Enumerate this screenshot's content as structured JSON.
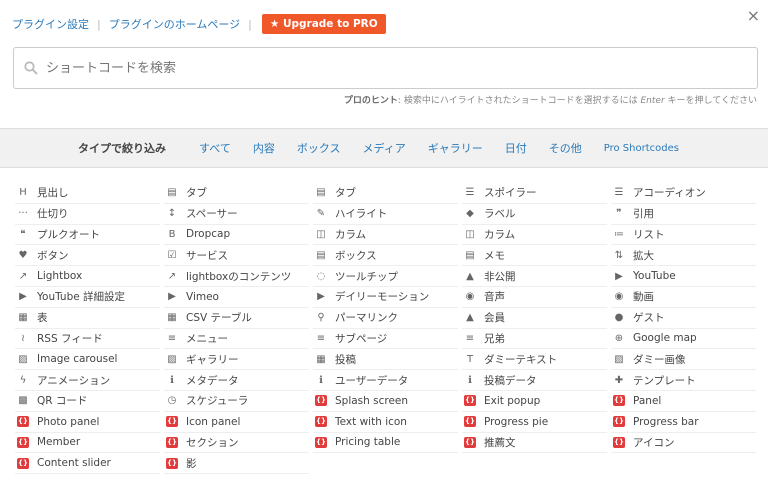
{
  "header": {
    "settings": "プラグイン設定",
    "homepage": "プラグインのホームページ",
    "upgrade": "★ Upgrade to PRO",
    "close": "×"
  },
  "search": {
    "placeholder": "ショートコードを検索"
  },
  "hint": {
    "label": "プロのヒント",
    "text": ": 検索中にハイライトされたショートコードを選択するには ",
    "key": "Enter",
    "tail": " キーを押してください"
  },
  "filter": {
    "label": "タイプで絞り込み",
    "options": [
      "すべて",
      "内容",
      "ボックス",
      "メディア",
      "ギャラリー",
      "日付",
      "その他",
      "Pro Shortcodes"
    ]
  },
  "items": [
    {
      "label": "見出し",
      "icon": "heading-icon",
      "g": "H"
    },
    {
      "label": "タブ",
      "icon": "tabs-icon",
      "g": "▤"
    },
    {
      "label": "タブ",
      "icon": "tab-icon",
      "g": "▤"
    },
    {
      "label": "スポイラー",
      "icon": "list-icon",
      "g": "☰"
    },
    {
      "label": "アコーディオン",
      "icon": "list-icon",
      "g": "☰"
    },
    {
      "label": "仕切り",
      "icon": "ellipsis-icon",
      "g": "···"
    },
    {
      "label": "スペーサー",
      "icon": "arrows-vertical-icon",
      "g": "↕"
    },
    {
      "label": "ハイライト",
      "icon": "pencil-icon",
      "g": "✎"
    },
    {
      "label": "ラベル",
      "icon": "tag-icon",
      "g": "◆"
    },
    {
      "label": "引用",
      "icon": "quote-icon",
      "g": "❞"
    },
    {
      "label": "プルクオート",
      "icon": "quote-left-icon",
      "g": "❝"
    },
    {
      "label": "Dropcap",
      "icon": "bold-icon",
      "g": "B"
    },
    {
      "label": "カラム",
      "icon": "columns-icon",
      "g": "◫"
    },
    {
      "label": "カラム",
      "icon": "columns-icon",
      "g": "◫"
    },
    {
      "label": "リスト",
      "icon": "list-ol-icon",
      "g": "≔"
    },
    {
      "label": "ボタン",
      "icon": "heart-icon",
      "g": "♥"
    },
    {
      "label": "サービス",
      "icon": "check-square-icon",
      "g": "☑"
    },
    {
      "label": "ボックス",
      "icon": "box-icon",
      "g": "▤"
    },
    {
      "label": "メモ",
      "icon": "note-icon",
      "g": "▤"
    },
    {
      "label": "拡大",
      "icon": "sort-icon",
      "g": "⇅"
    },
    {
      "label": "Lightbox",
      "icon": "external-link-icon",
      "g": "↗"
    },
    {
      "label": "lightboxのコンテンツ",
      "icon": "external-link-icon",
      "g": "↗"
    },
    {
      "label": "ツールチップ",
      "icon": "comment-icon",
      "g": "◌"
    },
    {
      "label": "非公開",
      "icon": "lock-icon",
      "g": "▲"
    },
    {
      "label": "YouTube",
      "icon": "youtube-icon",
      "g": "▶"
    },
    {
      "label": "YouTube 詳細設定",
      "icon": "youtube-icon",
      "g": "▶"
    },
    {
      "label": "Vimeo",
      "icon": "youtube-icon",
      "g": "▶"
    },
    {
      "label": "デイリーモーション",
      "icon": "youtube-icon",
      "g": "▶"
    },
    {
      "label": "音声",
      "icon": "play-circle-icon",
      "g": "◉"
    },
    {
      "label": "動画",
      "icon": "play-circle-icon",
      "g": "◉"
    },
    {
      "label": "表",
      "icon": "table-icon",
      "g": "▦"
    },
    {
      "label": "CSV テーブル",
      "icon": "table-icon",
      "g": "▦"
    },
    {
      "label": "パーマリンク",
      "icon": "link-icon",
      "g": "⚲"
    },
    {
      "label": "会員",
      "icon": "lock-icon",
      "g": "▲"
    },
    {
      "label": "ゲスト",
      "icon": "user-icon",
      "g": "●"
    },
    {
      "label": "RSS フィード",
      "icon": "rss-icon",
      "g": "≀"
    },
    {
      "label": "メニュー",
      "icon": "bars-icon",
      "g": "≡"
    },
    {
      "label": "サブページ",
      "icon": "bars-icon",
      "g": "≡"
    },
    {
      "label": "兄弟",
      "icon": "bars-icon",
      "g": "≡"
    },
    {
      "label": "Google map",
      "icon": "globe-icon",
      "g": "⊕"
    },
    {
      "label": "Image carousel",
      "icon": "image-icon",
      "g": "▨"
    },
    {
      "label": "ギャラリー",
      "icon": "image-icon",
      "g": "▨"
    },
    {
      "label": "投稿",
      "icon": "th-list-icon",
      "g": "▦"
    },
    {
      "label": "ダミーテキスト",
      "icon": "text-height-icon",
      "g": "T"
    },
    {
      "label": "ダミー画像",
      "icon": "image-icon",
      "g": "▨"
    },
    {
      "label": "アニメーション",
      "icon": "bolt-icon",
      "g": "ϟ"
    },
    {
      "label": "メタデータ",
      "icon": "info-icon",
      "g": "ℹ"
    },
    {
      "label": "ユーザーデータ",
      "icon": "info-icon",
      "g": "ℹ"
    },
    {
      "label": "投稿データ",
      "icon": "info-icon",
      "g": "ℹ"
    },
    {
      "label": "テンプレート",
      "icon": "puzzle-icon",
      "g": "✚"
    },
    {
      "label": "QR コード",
      "icon": "qrcode-icon",
      "g": "▩"
    },
    {
      "label": "スケジューラ",
      "icon": "clock-icon",
      "g": "◷"
    },
    {
      "label": "Splash screen",
      "icon": "pro-icon",
      "g": "{}",
      "pro": true
    },
    {
      "label": "Exit popup",
      "icon": "pro-icon",
      "g": "{}",
      "pro": true
    },
    {
      "label": "Panel",
      "icon": "pro-icon",
      "g": "{}",
      "pro": true
    },
    {
      "label": "Photo panel",
      "icon": "pro-icon",
      "g": "{}",
      "pro": true
    },
    {
      "label": "Icon panel",
      "icon": "pro-icon",
      "g": "{}",
      "pro": true
    },
    {
      "label": "Text with icon",
      "icon": "pro-icon",
      "g": "{}",
      "pro": true
    },
    {
      "label": "Progress pie",
      "icon": "pro-icon",
      "g": "{}",
      "pro": true
    },
    {
      "label": "Progress bar",
      "icon": "pro-icon",
      "g": "{}",
      "pro": true
    },
    {
      "label": "Member",
      "icon": "pro-icon",
      "g": "{}",
      "pro": true
    },
    {
      "label": "セクション",
      "icon": "pro-icon",
      "g": "{}",
      "pro": true
    },
    {
      "label": "Pricing table",
      "icon": "pro-icon",
      "g": "{}",
      "pro": true
    },
    {
      "label": "推薦文",
      "icon": "pro-icon",
      "g": "{}",
      "pro": true
    },
    {
      "label": "アイコン",
      "icon": "pro-icon",
      "g": "{}",
      "pro": true
    },
    {
      "label": "Content slider",
      "icon": "pro-icon",
      "g": "{}",
      "pro": true
    },
    {
      "label": "影",
      "icon": "pro-icon",
      "g": "{}",
      "pro": true
    }
  ]
}
